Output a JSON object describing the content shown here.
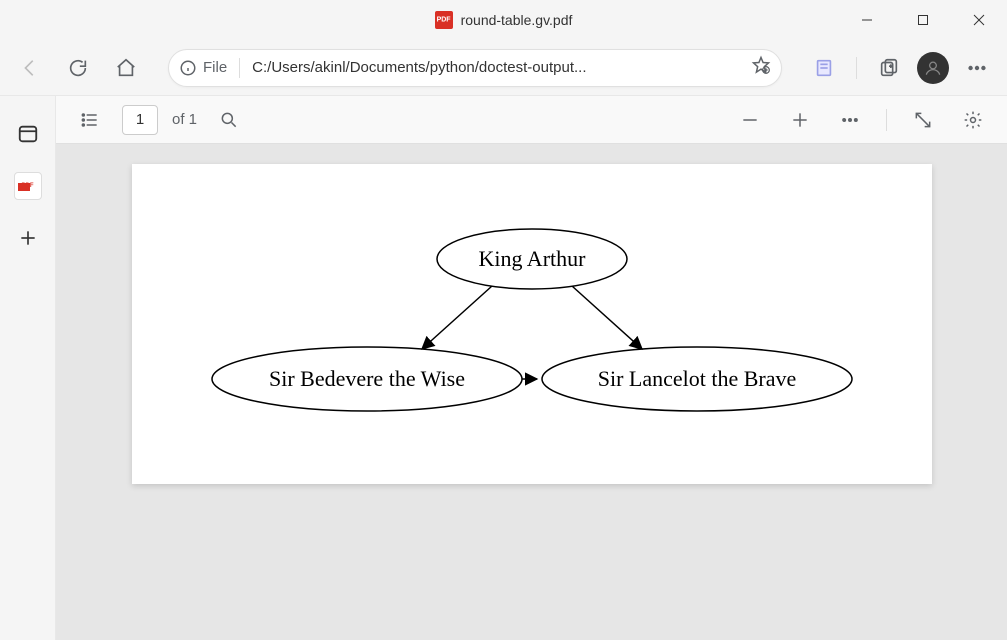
{
  "window": {
    "title": "round-table.gv.pdf"
  },
  "addressbar": {
    "scheme": "File",
    "url": "C:/Users/akinl/Documents/python/doctest-output..."
  },
  "pdf_toolbar": {
    "current_page": "1",
    "page_count_label": "of 1"
  },
  "graph": {
    "nodes": {
      "root": "King Arthur",
      "left": "Sir Bedevere the Wise",
      "right": "Sir Lancelot the Brave"
    }
  }
}
